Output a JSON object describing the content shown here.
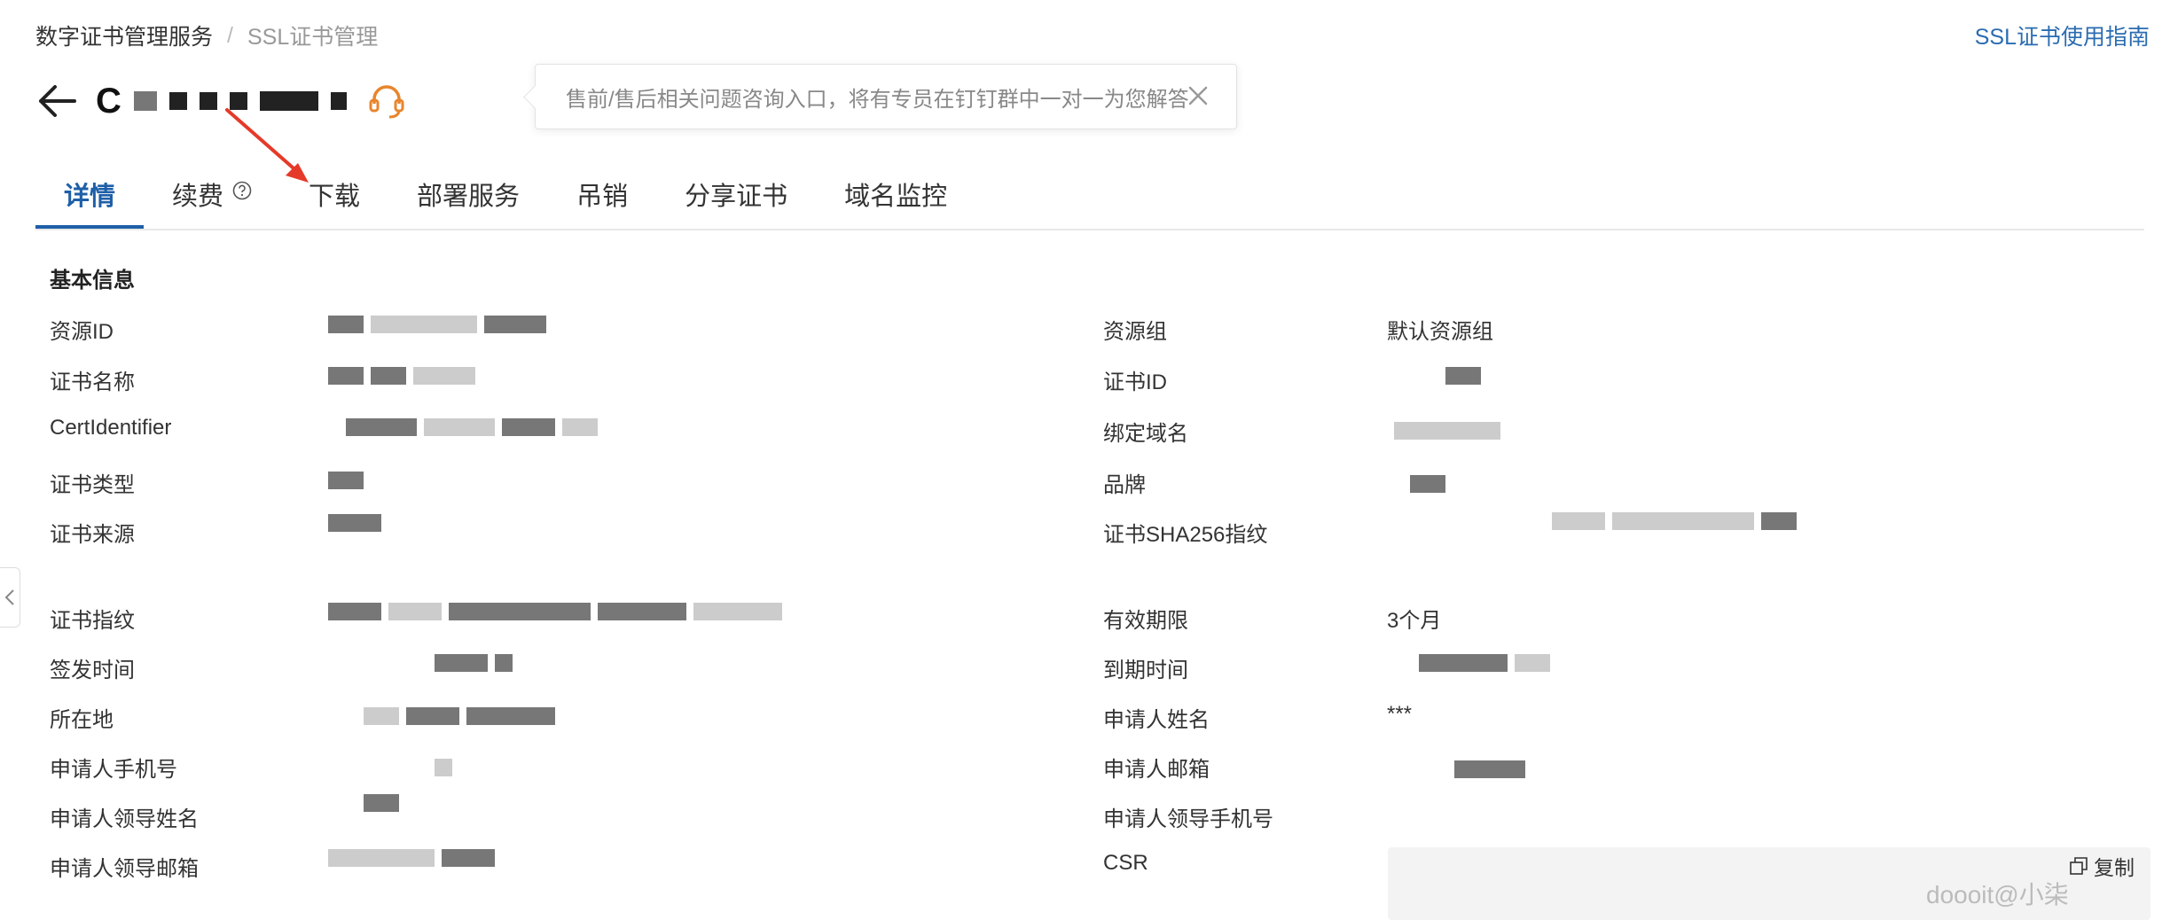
{
  "breadcrumb": {
    "root": "数字证书管理服务",
    "separator": "/",
    "current": "SSL证书管理"
  },
  "guide_link": "SSL证书使用指南",
  "title": {
    "prefix": "C"
  },
  "tooltip": {
    "text": "售前/售后相关问题咨询入口，将有专员在钉钉群中一对一为您解答"
  },
  "tabs": [
    {
      "label": "详情",
      "active": true
    },
    {
      "label": "续费",
      "active": false
    },
    {
      "label": "下载",
      "active": false
    },
    {
      "label": "部署服务",
      "active": false
    },
    {
      "label": "吊销",
      "active": false
    },
    {
      "label": "分享证书",
      "active": false
    },
    {
      "label": "域名监控",
      "active": false
    }
  ],
  "section_title": "基本信息",
  "left_fields": [
    {
      "label": "资源ID",
      "value": ""
    },
    {
      "label": "证书名称",
      "value": ""
    },
    {
      "label": "CertIdentifier",
      "value": ""
    },
    {
      "label": "证书类型",
      "value": ""
    },
    {
      "label": "证书来源",
      "value": ""
    },
    {
      "label": "证书指纹",
      "value": ""
    },
    {
      "label": "签发时间",
      "value": ""
    },
    {
      "label": "所在地",
      "value": ""
    },
    {
      "label": "申请人手机号",
      "value": ""
    },
    {
      "label": "申请人领导姓名",
      "value": ""
    },
    {
      "label": "申请人领导邮箱",
      "value": ""
    }
  ],
  "right_fields": [
    {
      "label": "资源组",
      "value": "默认资源组"
    },
    {
      "label": "证书ID",
      "value": ""
    },
    {
      "label": "绑定域名",
      "value": ""
    },
    {
      "label": "品牌",
      "value": ""
    },
    {
      "label": "证书SHA256指纹",
      "value": ""
    },
    {
      "label": "有效期限",
      "value": "3个月"
    },
    {
      "label": "到期时间",
      "value": ""
    },
    {
      "label": "申请人姓名",
      "value": "***"
    },
    {
      "label": "申请人邮箱",
      "value": ""
    },
    {
      "label": "申请人领导手机号",
      "value": ""
    },
    {
      "label": "CSR",
      "value": ""
    }
  ],
  "copy_label": "复制",
  "watermark": "doooit@小柒",
  "colors": {
    "accent": "#1e5fa8",
    "link": "#2b6cb0",
    "support_icon": "#e8852c",
    "annotation_arrow": "#e53a2a"
  }
}
